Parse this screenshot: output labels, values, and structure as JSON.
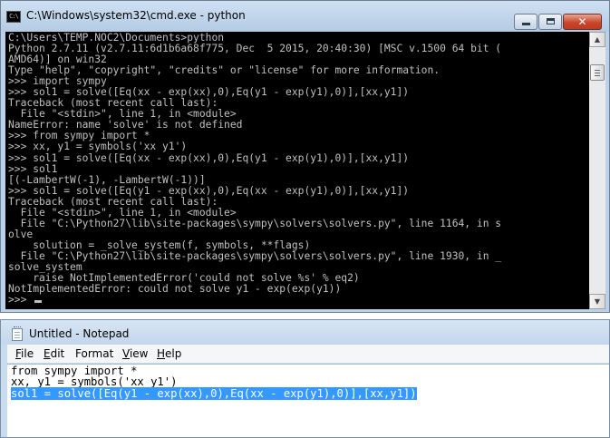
{
  "cmd": {
    "title": "C:\\Windows\\system32\\cmd.exe - python",
    "icon_text": "C:\\",
    "lines": [
      "C:\\Users\\TEMP.NOC2\\Documents>python",
      "Python 2.7.11 (v2.7.11:6d1b6a68f775, Dec  5 2015, 20:40:30) [MSC v.1500 64 bit (",
      "AMD64)] on win32",
      "Type \"help\", \"copyright\", \"credits\" or \"license\" for more information.",
      ">>> import sympy",
      ">>> sol1 = solve([Eq(xx - exp(xx),0),Eq(y1 - exp(y1),0)],[xx,y1])",
      "Traceback (most recent call last):",
      "  File \"<stdin>\", line 1, in <module>",
      "NameError: name 'solve' is not defined",
      ">>> from sympy import *",
      ">>> xx, y1 = symbols('xx y1')",
      ">>> sol1 = solve([Eq(xx - exp(xx),0),Eq(y1 - exp(y1),0)],[xx,y1])",
      ">>> sol1",
      "[(-LambertW(-1), -LambertW(-1))]",
      ">>> sol1 = solve([Eq(y1 - exp(xx),0),Eq(xx - exp(y1),0)],[xx,y1])",
      "Traceback (most recent call last):",
      "  File \"<stdin>\", line 1, in <module>",
      "  File \"C:\\Python27\\lib\\site-packages\\sympy\\solvers\\solvers.py\", line 1164, in s",
      "olve",
      "    solution = _solve_system(f, symbols, **flags)",
      "  File \"C:\\Python27\\lib\\site-packages\\sympy\\solvers\\solvers.py\", line 1930, in _",
      "solve_system",
      "    raise NotImplementedError('could not solve %s' % eq2)",
      "NotImplementedError: could not solve y1 - exp(exp(y1))"
    ],
    "prompt": ">>> "
  },
  "notepad": {
    "title": "Untitled - Notepad",
    "menu": [
      {
        "first": "F",
        "rest": "ile"
      },
      {
        "first": "E",
        "rest": "dit"
      },
      {
        "first": "",
        "rest": "Format",
        "ul_index": 1
      },
      {
        "first": "V",
        "rest": "iew"
      },
      {
        "first": "H",
        "rest": "elp"
      }
    ],
    "menu_labels": [
      "File",
      "Edit",
      "Format",
      "View",
      "Help"
    ],
    "lines": [
      "from sympy import *",
      "xx, y1 = symbols('xx y1')",
      "sol1 = solve([Eq(y1 - exp(xx),0),Eq(xx - exp(y1),0)],[xx,y1])"
    ],
    "selected_line_index": 2
  }
}
